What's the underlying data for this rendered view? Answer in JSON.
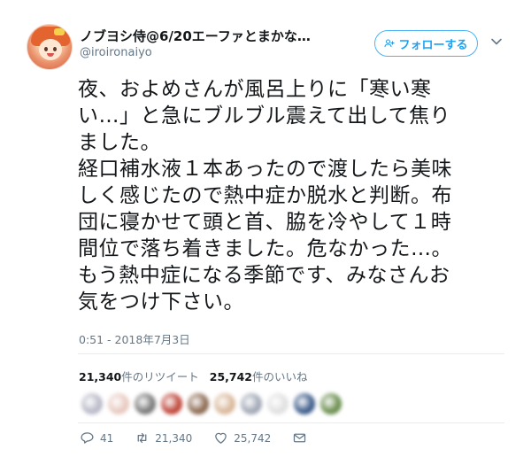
{
  "header": {
    "display_name": "ノブヨシ侍@6/20エーファとまかな…",
    "username": "@iroironaiyo",
    "follow_label": "フォローする"
  },
  "tweet": {
    "lines": [
      "夜、およめさんが風呂上りに「寒い寒",
      "い…」と急にブルブル震えて出して焦り",
      "ました。",
      "経口補水液１本あったので渡したら美味",
      "しく感じたので熱中症か脱水と判断。布",
      "団に寝かせて頭と首、脇を冷やして１時",
      "間位で落ち着きました。危なかった…。",
      "もう熱中症になる季節です、みなさんお",
      "気をつけ下さい。"
    ],
    "timestamp": "0:51 - 2018年7月3日"
  },
  "stats": {
    "retweets_count": "21,340",
    "retweets_label": "件のリツイート",
    "likes_count": "25,742",
    "likes_label": "件のいいね"
  },
  "likers": {
    "colors": [
      "#b9b9c9",
      "#e8c9c0",
      "#7a7a7a",
      "#c0463a",
      "#8c6a52",
      "#d9b89a",
      "#a0a7b5",
      "#e0e0e0",
      "#3d5c8a",
      "#6b8e4e"
    ]
  },
  "actions": {
    "replies": "41",
    "retweets": "21,340",
    "likes": "25,742"
  },
  "colors": {
    "accent": "#1da1f2",
    "muted": "#657786",
    "retweet": "#17bf63",
    "like": "#e0245e"
  }
}
